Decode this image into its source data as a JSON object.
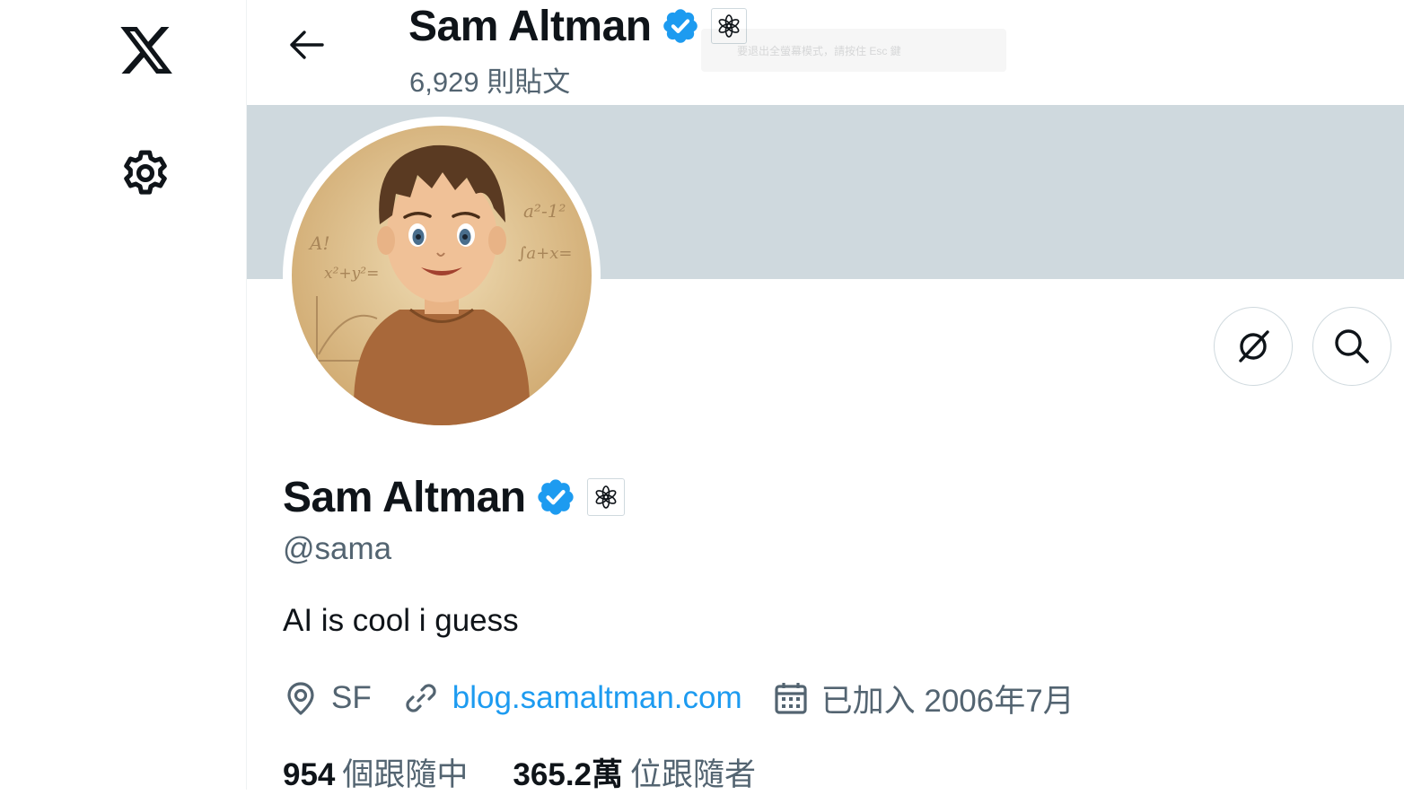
{
  "header": {
    "name": "Sam Altman",
    "posts_count": "6,929 則貼文",
    "toast_text": "要退出全螢幕模式，請按住 Esc 鍵"
  },
  "profile": {
    "name": "Sam Altman",
    "handle": "@sama",
    "bio": "AI is cool i guess",
    "location": "SF",
    "website": "blog.samaltman.com",
    "joined": "已加入 2006年7月",
    "following_count": "954",
    "following_label": "個跟隨中",
    "followers_count": "365.2萬",
    "followers_label": "位跟隨者"
  },
  "avatar_chalk": [
    "A!",
    "x²+y²=",
    "a²-1²",
    "∫a+x="
  ],
  "icons": {
    "logo": "x-logo",
    "settings": "gear-icon",
    "back": "arrow-left-icon",
    "verified": "verified-badge-icon",
    "affiliate": "openai-logo-icon",
    "grok": "grok-icon",
    "search": "search-icon",
    "location": "location-pin-icon",
    "link": "link-icon",
    "calendar": "calendar-icon"
  },
  "colors": {
    "accent": "#1d9bf0",
    "secondary_text": "#536471",
    "banner": "#cfd9de"
  }
}
